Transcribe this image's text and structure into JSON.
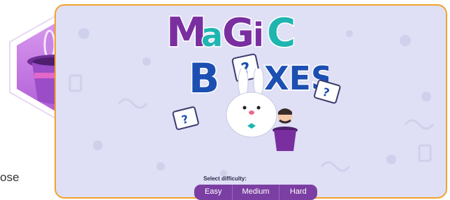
{
  "side_text": "ose",
  "title": {
    "line1": [
      "M",
      "a",
      "G",
      "i",
      "C"
    ],
    "line2_before": "B",
    "line2_after": "XES"
  },
  "difficulty": {
    "label": "Select difficulty:",
    "options": [
      "Easy",
      "Medium",
      "Hard"
    ]
  },
  "cards": [
    "?",
    "?"
  ],
  "colors": {
    "frame_border": "#f3a22c",
    "background": "#dfe0f5",
    "title_purple": "#7a2fa0",
    "title_teal": "#1fb5b0",
    "title_blue": "#1c4fb2",
    "button_bar": "#7b3fa3",
    "badge_hat": "#b06ad8"
  }
}
